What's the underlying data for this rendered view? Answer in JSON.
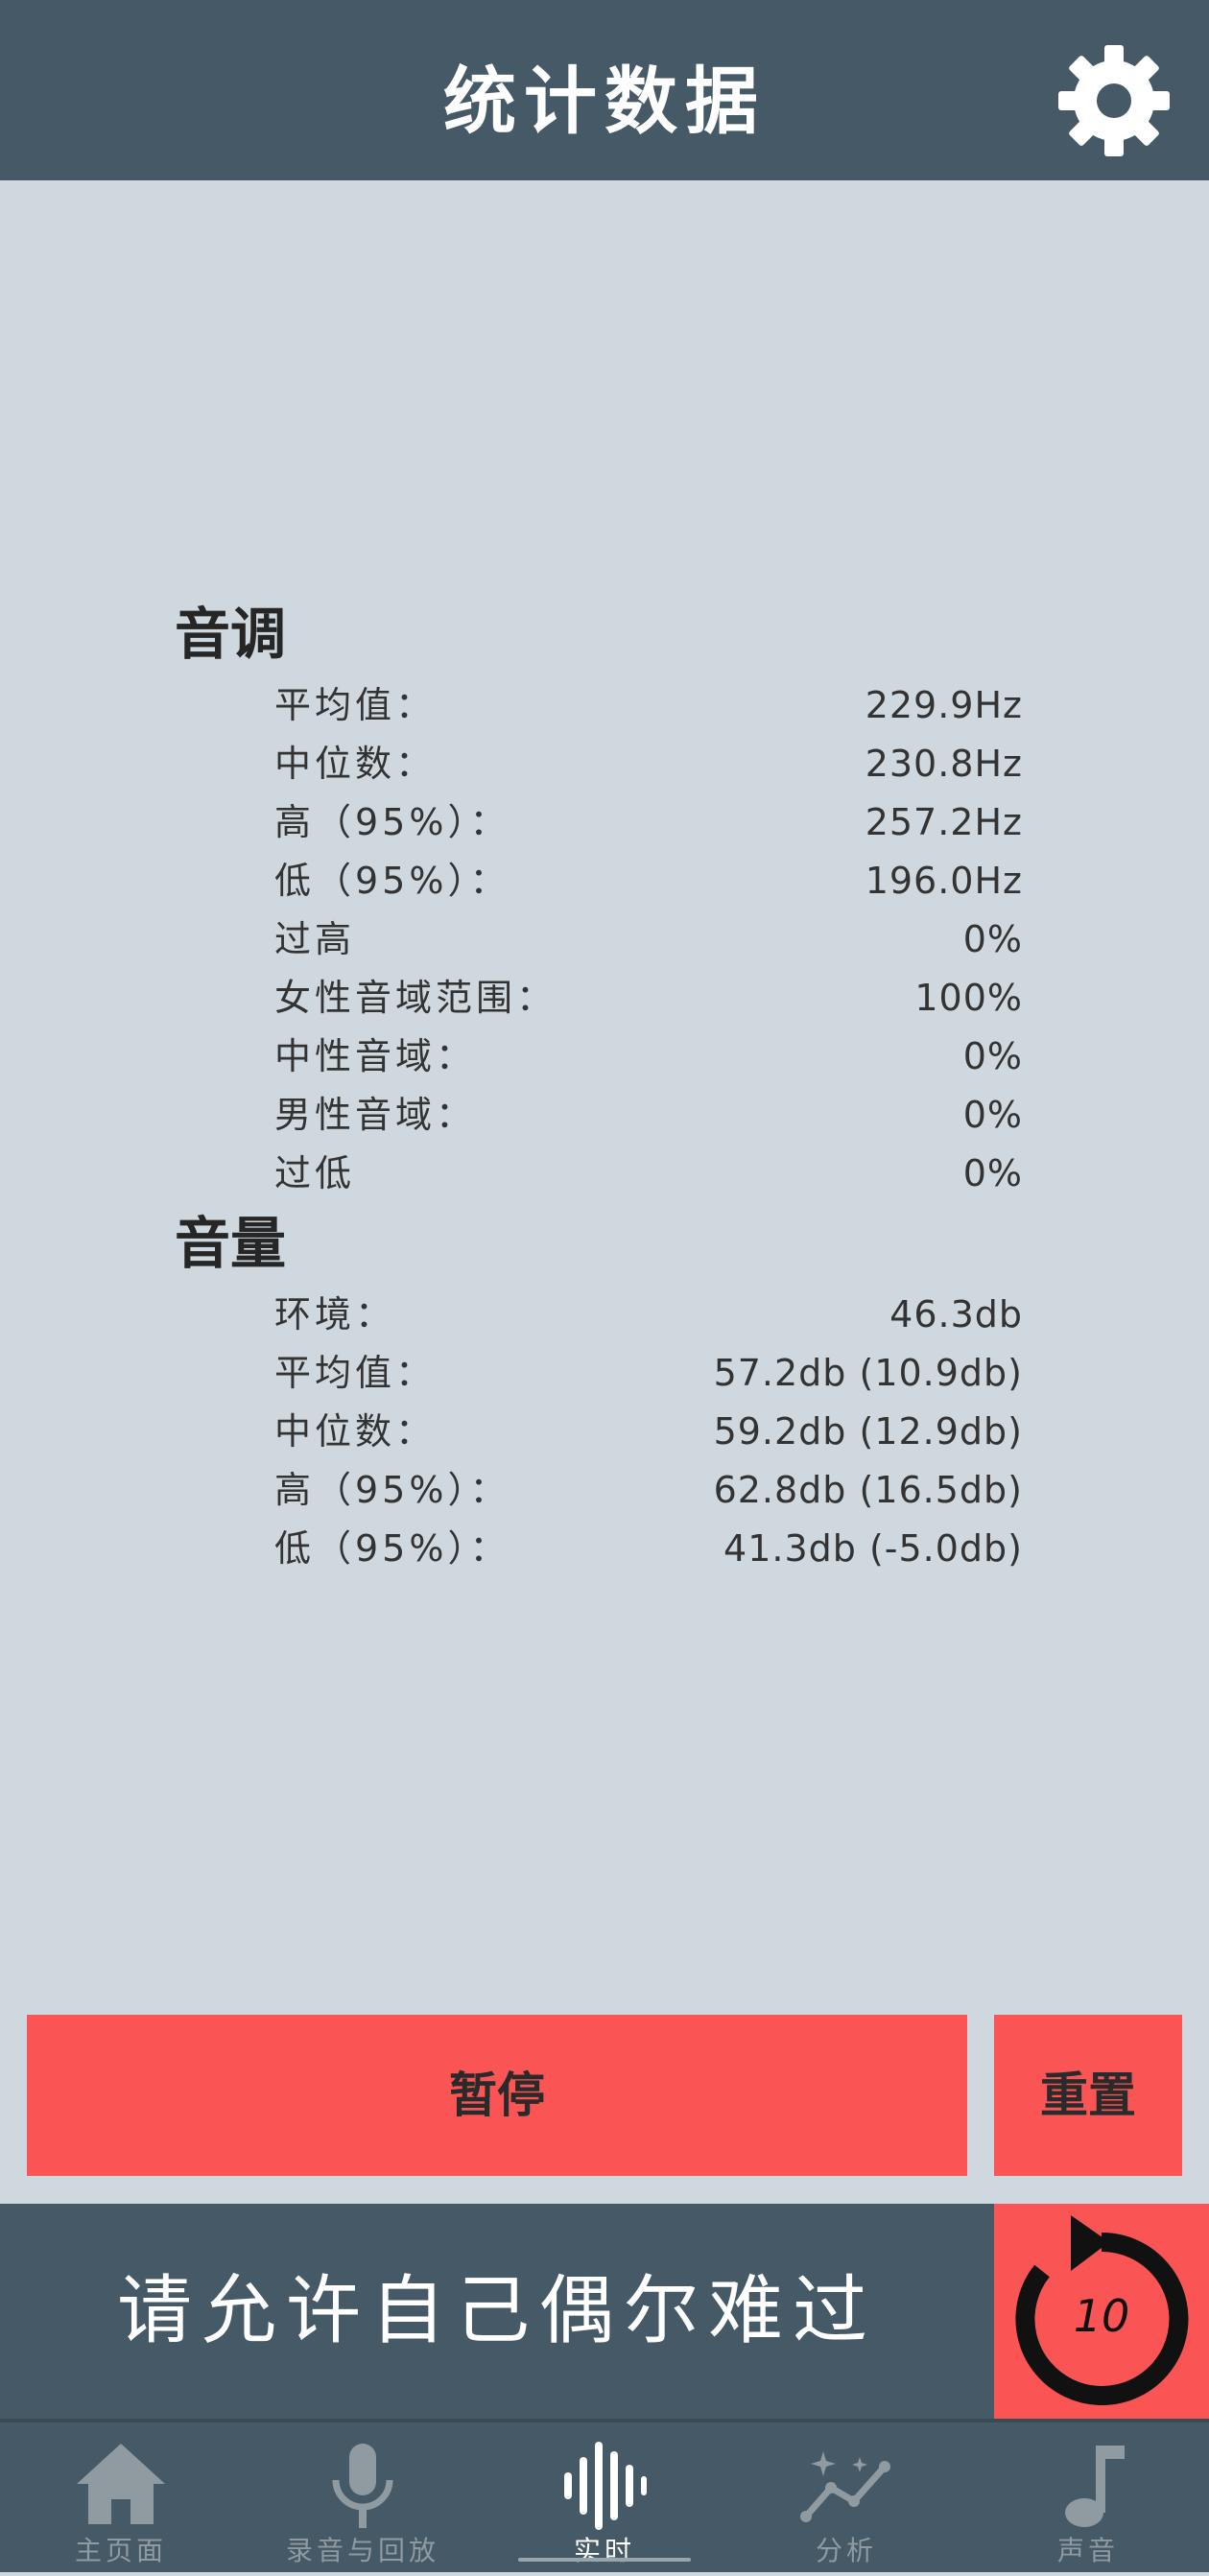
{
  "header": {
    "title": "统计数据",
    "settings_icon": "gear-icon"
  },
  "pitch": {
    "title": "音调",
    "rows": [
      {
        "label": "平均值：",
        "value": "229.9Hz"
      },
      {
        "label": "中位数：",
        "value": "230.8Hz"
      },
      {
        "label": "高（95%）：",
        "value": "257.2Hz"
      },
      {
        "label": "低（95%）：",
        "value": "196.0Hz"
      },
      {
        "label": "过高",
        "value": "0%"
      },
      {
        "label": "女性音域范围：",
        "value": "100%"
      },
      {
        "label": "中性音域：",
        "value": "0%"
      },
      {
        "label": "男性音域：",
        "value": "0%"
      },
      {
        "label": "过低",
        "value": "0%"
      }
    ]
  },
  "volume": {
    "title": "音量",
    "rows": [
      {
        "label": "环境：",
        "value": "46.3db"
      },
      {
        "label": "平均值：",
        "value": "57.2db (10.9db)"
      },
      {
        "label": "中位数：",
        "value": "59.2db (12.9db)"
      },
      {
        "label": "高（95%）：",
        "value": "62.8db (16.5db)"
      },
      {
        "label": "低（95%）：",
        "value": "41.3db (-5.0db)"
      }
    ]
  },
  "buttons": {
    "pause_label": "暂停",
    "reset_label": "重置"
  },
  "banner": {
    "text": "请允许自己偶尔难过",
    "replay_icon": "replay-icon",
    "replay_seconds": "10"
  },
  "nav": {
    "items": [
      {
        "label": "主页面",
        "icon": "home-icon"
      },
      {
        "label": "录音与回放",
        "icon": "microphone-icon"
      },
      {
        "label": "实时",
        "icon": "waveform-icon",
        "active": true
      },
      {
        "label": "分析",
        "icon": "analysis-icon"
      },
      {
        "label": "声音",
        "icon": "music-note-icon"
      }
    ]
  },
  "colors": {
    "header_bg": "#455a66",
    "page_bg": "#cfd8de",
    "accent": "#fb5454"
  }
}
